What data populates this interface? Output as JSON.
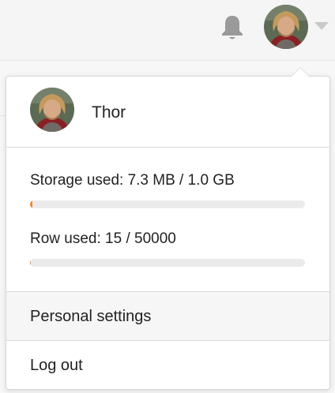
{
  "header": {
    "notifications_icon": "bell-icon",
    "avatar_icon": "user-avatar",
    "menu_toggle_icon": "caret-down-icon"
  },
  "user_menu": {
    "username": "Thor",
    "storage": {
      "label": "Storage used: 7.3 MB / 1.0 GB",
      "used_fraction": 0.007,
      "bar_color": "#f5821f"
    },
    "rows": {
      "label": "Row used: 15 / 50000",
      "used_fraction": 0.0003,
      "bar_color": "#f5821f"
    },
    "items": [
      {
        "label": "Personal settings"
      },
      {
        "label": "Log out"
      }
    ]
  },
  "colors": {
    "accent": "#f5821f",
    "bar_track": "#ebebeb"
  }
}
